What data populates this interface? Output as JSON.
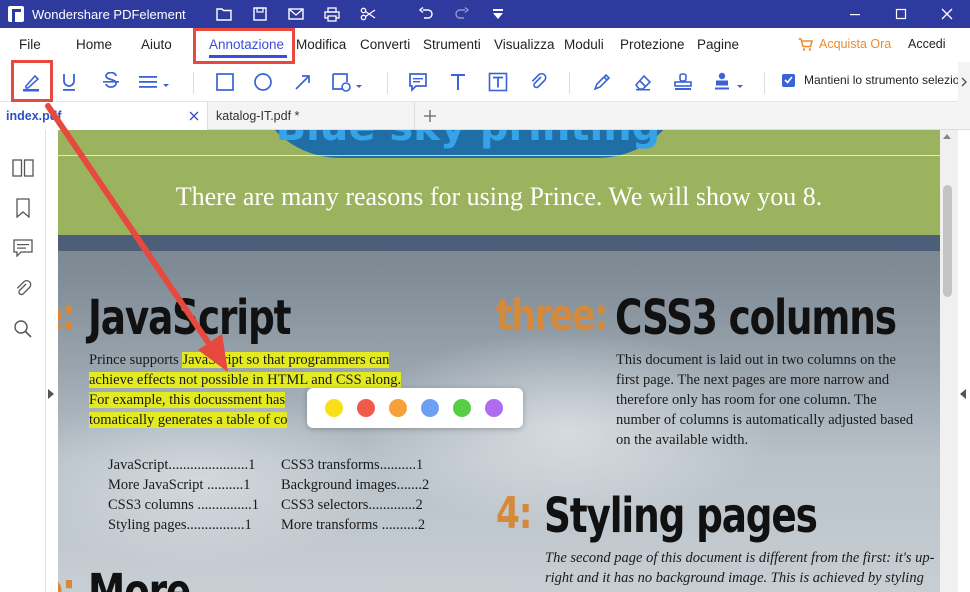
{
  "app": {
    "title": "Wondershare PDFelement"
  },
  "menu": {
    "items": [
      "File",
      "Home",
      "Aiuto",
      "Annotazione",
      "Modifica",
      "Converti",
      "Strumenti",
      "Visualizza",
      "Moduli",
      "Protezione",
      "Pagine"
    ],
    "active": "Annotazione",
    "buy": "Acquista Ora",
    "login": "Accedi"
  },
  "toolbar": {
    "keep_tool_label": "Mantieni lo strumento selezio",
    "keep_tool_checked": true
  },
  "tabs": [
    {
      "label": "index.pdf",
      "active": true
    },
    {
      "label": "katalog-IT.pdf *",
      "active": false
    }
  ],
  "doc": {
    "banner_partial_title": "Blue sky printing",
    "banner_text": "There are many reasons for using Prince. We will show you 8.",
    "sec1": {
      "num": "e:",
      "title": "JavaScript",
      "lines": [
        "Prince supports JavaScript so that programmers can",
        "achieve effects not possible in HTML and CSS along.",
        "For example, this docussment has",
        "tomatically generates a table of co"
      ]
    },
    "toc_left": [
      "JavaScript......................1",
      "More JavaScript ..........1",
      "CSS3 columns ...............1",
      "Styling pages................1"
    ],
    "toc_right": [
      "CSS3 transforms..........1",
      "Background images.......2",
      "CSS3 selectors.............2",
      "More transforms ..........2"
    ],
    "sec_more": {
      "num": "e:",
      "title": "More"
    },
    "sec3": {
      "num": "three:",
      "title": "CSS3 columns",
      "lines": [
        "This document is laid out in two columns on the",
        "first page. The next pages are more narrow and",
        "therefore only has room for one column. The",
        "number of columns is automatically adjusted based",
        "on the available width."
      ]
    },
    "sec4": {
      "num": "4:",
      "title": "Styling pages",
      "lines": [
        "The second page of this document is different from the first: it's up-",
        "right and it has no background image. This is achieved by styling"
      ]
    }
  },
  "palette": {
    "colors": [
      "#f7e017",
      "#f05a4b",
      "#f7a13b",
      "#6da0f2",
      "#57cd45",
      "#b06cf0"
    ]
  },
  "colors": {
    "titlebar": "#2f3a9e",
    "accent": "#3a4fd8",
    "highlight": "#e3ea22",
    "annotation_red": "#e8493f",
    "buy_orange": "#f08c2c"
  }
}
